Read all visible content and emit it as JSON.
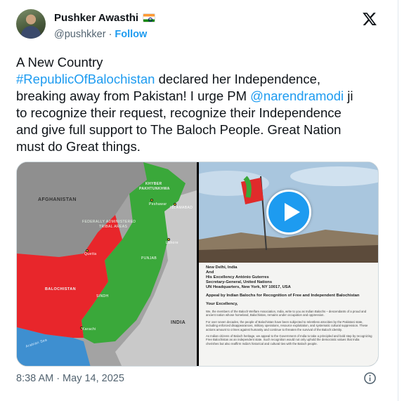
{
  "author": {
    "display_name": "Pushker Awasthi",
    "handle": "@pushkker",
    "separator": "·",
    "follow_label": "Follow",
    "flag_icon": "india-flag-icon",
    "avatar_icon": "user-avatar"
  },
  "brand": {
    "logo_icon": "x-logo-icon"
  },
  "tweet": {
    "line1": "A New Country",
    "hashtag": "#RepublicOfBalochistan",
    "line2_rest": " declared her Independence,",
    "line3": "breaking away from Pakistan! I urge PM ",
    "mention": "@narendramodi",
    "line3_rest": " ji",
    "line4": "to recognize their request, recognize their Independence",
    "line5": "and give full support to The Baloch People. Great Nation",
    "line6": "must do Great things."
  },
  "media": {
    "map": {
      "labels": {
        "afghanistan": "AFGHANISTAN",
        "kpk1": "KHYBER",
        "kpk2": "PAKHTUNKHWA",
        "fata1": "FEDERALLY ADMINISTERED",
        "fata2": "TRIBAL AREAS",
        "peshawar": "Peshawar",
        "islamabad": "ISLAMABAD",
        "quetta": "Quetta",
        "lahore": "Lahore",
        "punjab": "PUNJAB",
        "balochistan": "BALOCHISTAN",
        "sindh": "SINDH",
        "karachi": "Karachi",
        "india": "INDIA",
        "sea": "Arabian Sea"
      }
    },
    "video": {
      "play_icon": "play-icon"
    },
    "letter": {
      "lines": [
        "New Delhi, India",
        "And",
        "His Excellency António Guterres",
        "Secretary-General, United Nations",
        "UN Headquarters, New York, NY 10017, USA"
      ],
      "subject": "Appeal by Indian Balochs for Recognition of Free and Independent Balochistan",
      "salutation": "Your Excellency,",
      "para1": "We, the members of the Baloch Welfare Association, India, write to you as Indian Balochs – descendants of a proud and ancient nation whose homeland, Balochistan, remains under occupation and oppression.",
      "para2": "For over seven decades, the people of Balochistan have been subjected to relentless atrocities by the Pakistani state, including enforced disappearances, military operations, resource exploitation, and systematic cultural suppression. These actions amount to crimes against humanity and continue to threaten the survival of the Baloch identity.",
      "para3": "As Indian citizens of Baloch heritage, we appeal to the Government of India to take a principled and bold step by recognizing Free Balochistan as an independent state. Such recognition would not only uphold the democratic values that India cherishes but also reaffirm India's historical and cultural ties with the Baloch people."
    }
  },
  "footer": {
    "time": "8:38 AM",
    "separator": "·",
    "date": "May 14, 2025",
    "info_icon": "info-icon"
  },
  "colors": {
    "link": "#1d9bf0",
    "text": "#0f1419",
    "muted": "#536471",
    "balochistan_red": "#e8262b",
    "pakistan_green": "#3aa83a",
    "afghanistan_gray": "#9a9a9a"
  }
}
